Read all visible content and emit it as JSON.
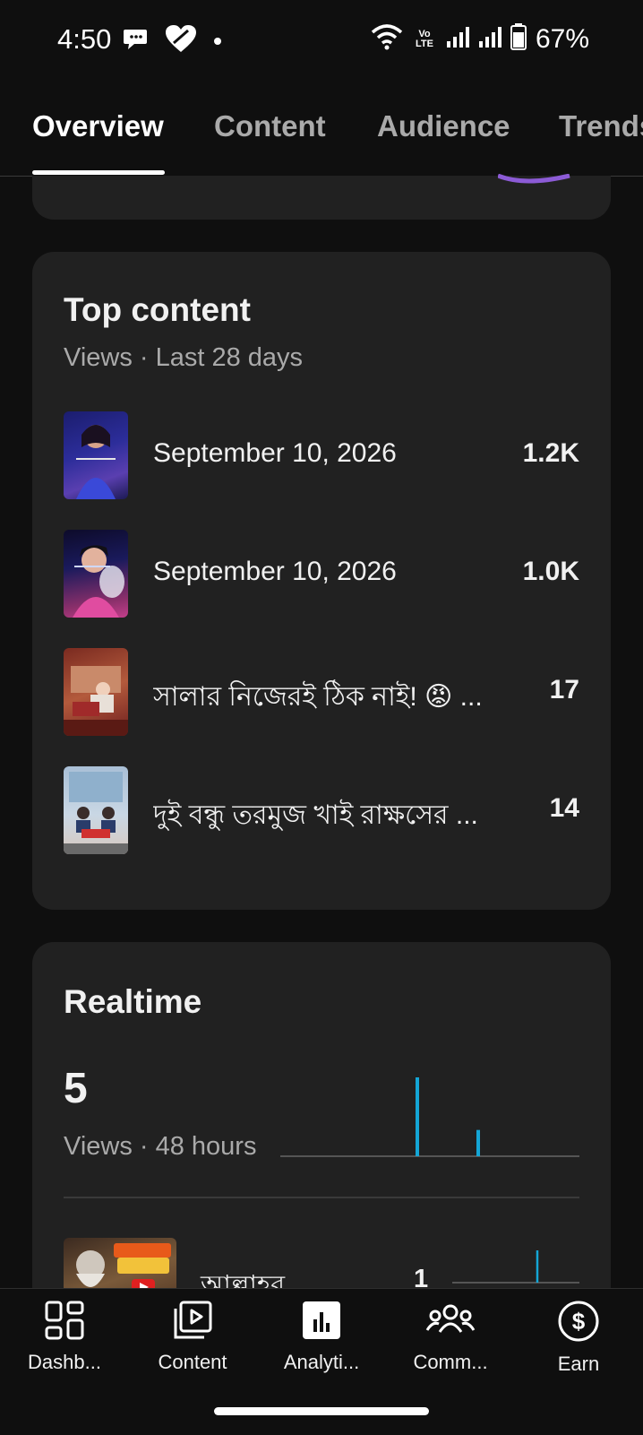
{
  "status_bar": {
    "time": "4:50",
    "battery": "67%",
    "network_label": "Vo LTE"
  },
  "tabs": [
    {
      "label": "Overview",
      "active": true
    },
    {
      "label": "Content",
      "active": false
    },
    {
      "label": "Audience",
      "active": false
    },
    {
      "label": "Trends",
      "active": false
    }
  ],
  "top_content": {
    "title": "Top content",
    "subtitle": "Views · Last 28 days",
    "items": [
      {
        "title": "September 10, 2026",
        "value": "1.2K"
      },
      {
        "title": "September 10, 2026",
        "value": "1.0K"
      },
      {
        "title": "সালার নিজেরই ঠিক নাই! 😡 ...",
        "value": "17"
      },
      {
        "title": "দুই বন্ধু তরমুজ খাই রাক্ষসের ...",
        "value": "14"
      }
    ]
  },
  "realtime": {
    "title": "Realtime",
    "value": "5",
    "subtitle": "Views · 48 hours",
    "chart_spikes": [
      3,
      1
    ],
    "top_item": {
      "title": "আল্লাহর...",
      "value": "1"
    },
    "accent_color": "#14a6d6"
  },
  "bottom_nav": [
    {
      "label": "Dashb...",
      "icon": "dashboard-icon"
    },
    {
      "label": "Content",
      "icon": "content-icon"
    },
    {
      "label": "Analyti...",
      "icon": "analytics-icon",
      "active": true
    },
    {
      "label": "Comm...",
      "icon": "community-icon"
    },
    {
      "label": "Earn",
      "icon": "earn-icon"
    }
  ]
}
